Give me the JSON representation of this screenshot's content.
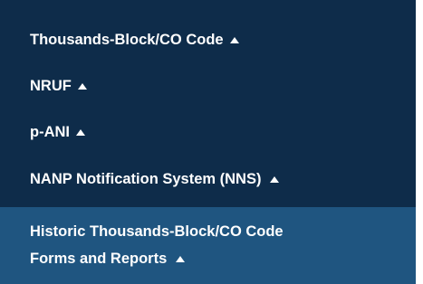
{
  "menu": {
    "items": [
      {
        "label": "Thousands-Block/CO Code"
      },
      {
        "label": "NRUF"
      },
      {
        "label": "p-ANI"
      },
      {
        "label": "NANP Notification System (NNS)"
      },
      {
        "label_line1": "Historic Thousands-Block/CO Code",
        "label_line2": "Forms and Reports"
      }
    ]
  },
  "colors": {
    "menu_background": "#0e2c4a",
    "active_item_background": "#1f5580",
    "text": "#ffffff"
  },
  "icons": {
    "expand_indicator": "triangle-up-icon"
  }
}
